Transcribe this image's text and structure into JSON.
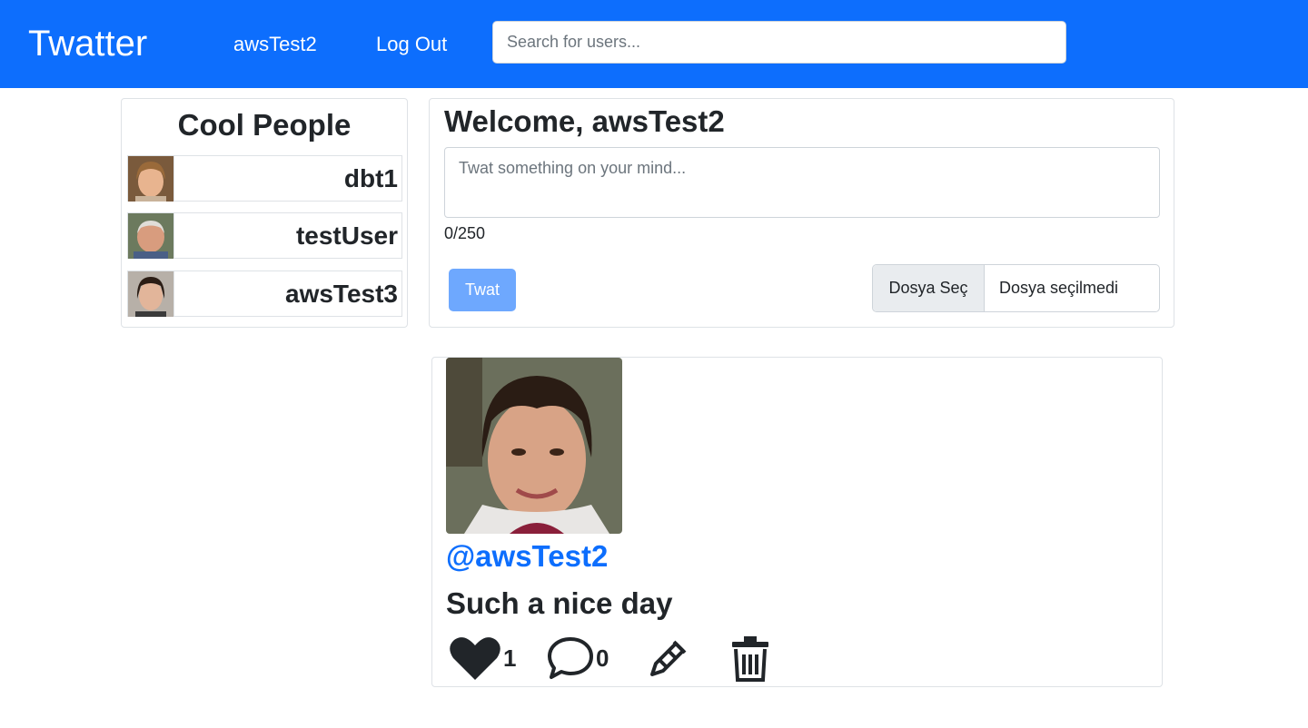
{
  "navbar": {
    "brand": "Twatter",
    "username": "awsTest2",
    "logout_label": "Log Out",
    "search_placeholder": "Search for users..."
  },
  "people": {
    "title": "Cool People",
    "items": [
      {
        "name": "dbt1"
      },
      {
        "name": "testUser"
      },
      {
        "name": "awsTest3"
      }
    ]
  },
  "composer": {
    "welcome": "Welcome, awsTest2",
    "placeholder": "Twat something on your mind...",
    "counter": "0/250",
    "submit_label": "Twat",
    "file_button_label": "Dosya Seç",
    "file_status": "Dosya seçilmedi"
  },
  "post": {
    "handle": "@awsTest2",
    "text": "Such a nice day",
    "likes": "1",
    "comments": "0"
  },
  "colors": {
    "primary": "#0d6efd",
    "primary_light": "#6ea8fe",
    "border": "#dee2e6"
  }
}
